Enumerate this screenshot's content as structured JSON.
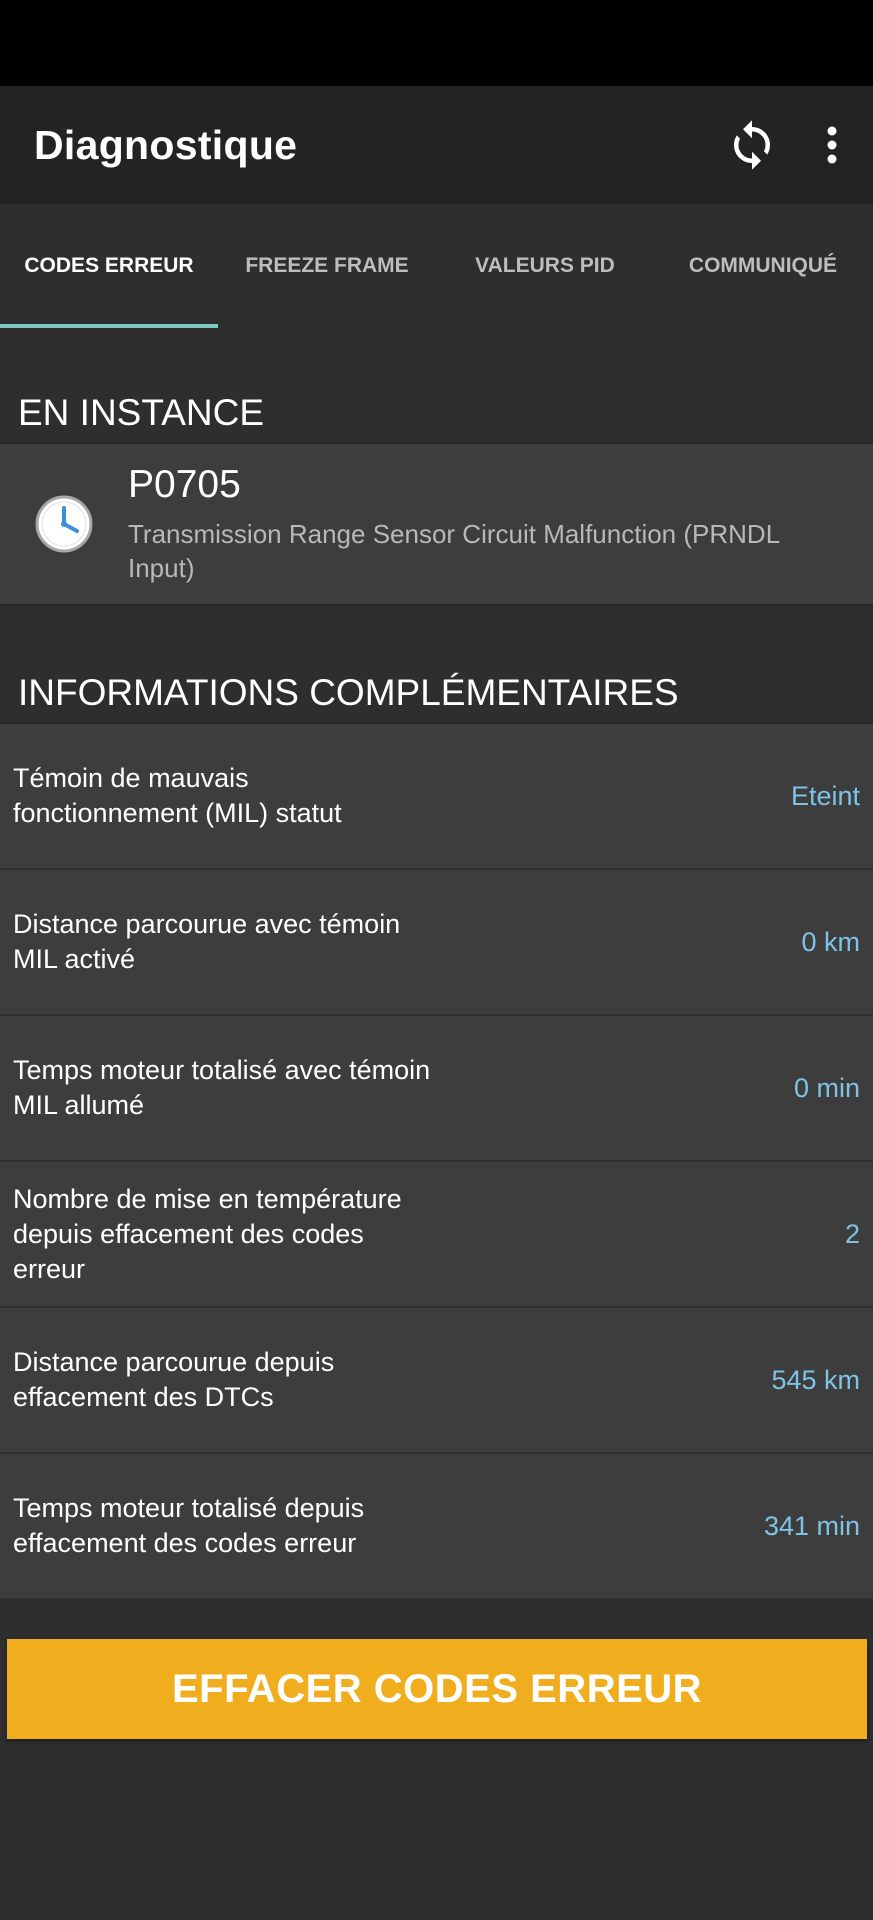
{
  "app_bar": {
    "title": "Diagnostique",
    "actions": [
      {
        "icon": "refresh-icon"
      },
      {
        "icon": "more-vert-icon"
      }
    ]
  },
  "tabs": [
    {
      "label": "CODES ERREUR",
      "active": true
    },
    {
      "label": "FREEZE FRAME",
      "active": false
    },
    {
      "label": "VALEURS PID",
      "active": false
    },
    {
      "label": "COMMUNIQUÉ",
      "active": false
    }
  ],
  "pending": {
    "header": "EN INSTANCE",
    "codes": [
      {
        "code": "P0705",
        "description": "Transmission Range Sensor Circuit Malfunction (PRNDL Input)",
        "icon": "clock-icon"
      }
    ]
  },
  "info": {
    "header": "INFORMATIONS COMPLÉMENTAIRES",
    "rows": [
      {
        "label": "Témoin de mauvais fonctionnement (MIL) statut",
        "value": "Eteint"
      },
      {
        "label": "Distance parcourue avec témoin MIL activé",
        "value": "0 km"
      },
      {
        "label": "Temps moteur totalisé avec témoin MIL allumé",
        "value": "0 min"
      },
      {
        "label": "Nombre de mise en température depuis effacement des codes erreur",
        "value": "2"
      },
      {
        "label": "Distance parcourue depuis effacement des DTCs",
        "value": "545 km"
      },
      {
        "label": "Temps moteur totalisé depuis effacement des codes erreur",
        "value": "341 min"
      }
    ]
  },
  "clear_button": {
    "label": "EFFACER CODES ERREUR"
  },
  "colors": {
    "accent_tab": "#7ec9c4",
    "value_text": "#7ec3e6",
    "button_bg": "#f0ae1f",
    "clock_blue": "#3b8fd6"
  }
}
